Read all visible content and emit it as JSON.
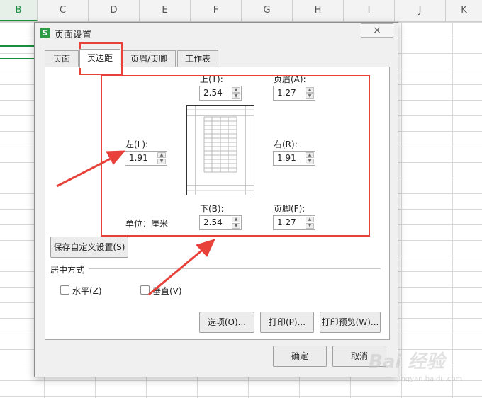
{
  "sheet": {
    "columns": [
      "B",
      "C",
      "D",
      "E",
      "F",
      "G",
      "H",
      "I",
      "J",
      "K"
    ],
    "selected_column": "B",
    "accent": "#1a8f3c"
  },
  "dialog": {
    "icon": "S",
    "title": "页面设置",
    "close": "×",
    "tabs": [
      "页面",
      "页边距",
      "页眉/页脚",
      "工作表"
    ],
    "active_tab": "页边距",
    "margins": {
      "top_label": "上(T):",
      "top_value": "2.54",
      "header_label": "页眉(A):",
      "header_value": "1.27",
      "left_label": "左(L):",
      "left_value": "1.91",
      "right_label": "右(R):",
      "right_value": "1.91",
      "bottom_label": "下(B):",
      "bottom_value": "2.54",
      "footer_label": "页脚(F):",
      "footer_value": "1.27",
      "unit_label": "单位：厘米"
    },
    "save_custom_label": "保存自定义设置(S)",
    "center_section_label": "居中方式",
    "center_horizontal_label": "水平(Z)",
    "center_vertical_label": "垂直(V)",
    "center_horizontal_checked": false,
    "center_vertical_checked": false,
    "options_label": "选项(O)...",
    "print_label": "打印(P)...",
    "print_preview_label": "打印预览(W)...",
    "ok_label": "确定",
    "cancel_label": "取消"
  },
  "annotation": {
    "color": "#e8413a"
  },
  "watermark": {
    "text": "Bai 经验",
    "sub": "jingyan.baidu.com"
  }
}
